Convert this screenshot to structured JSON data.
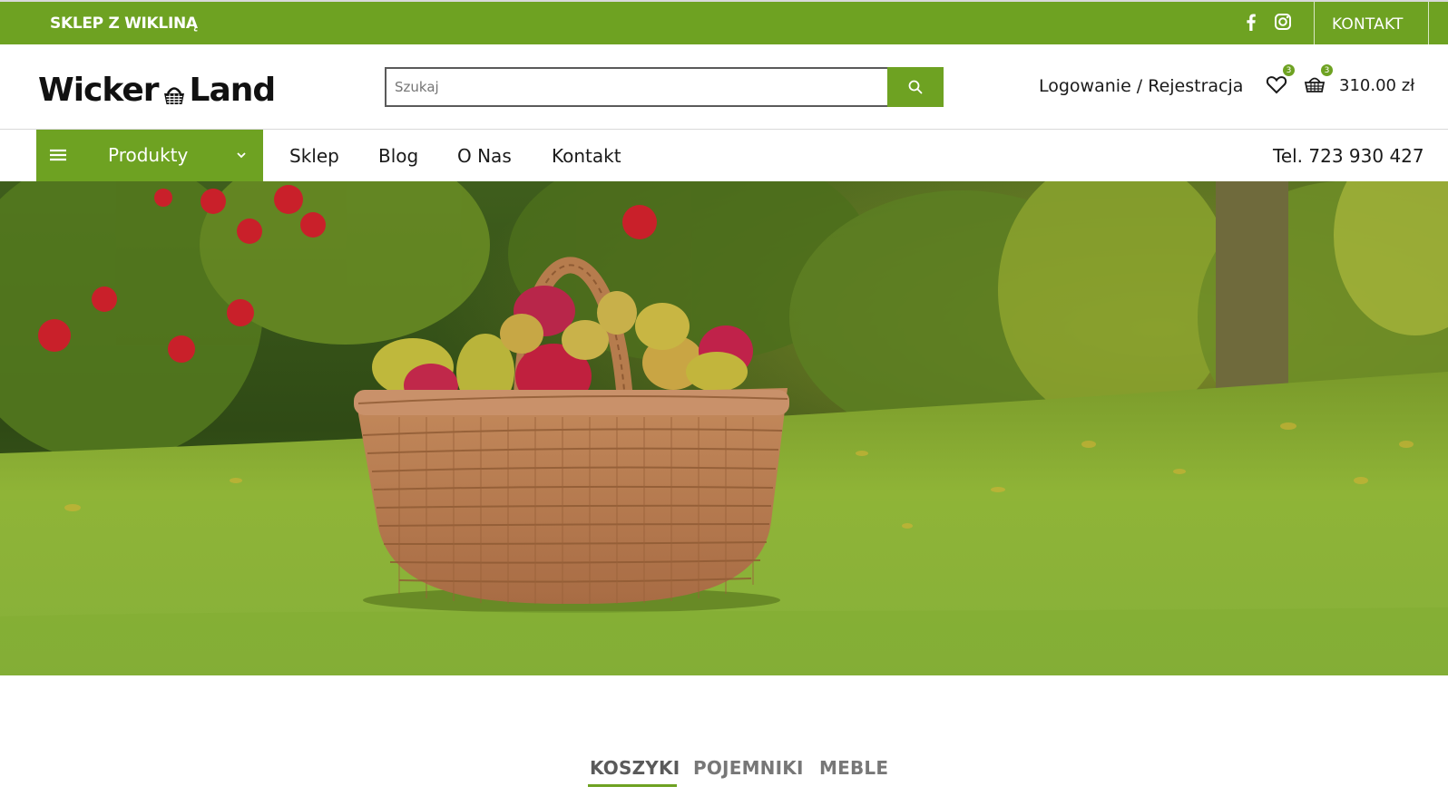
{
  "topbar": {
    "tagline": "SKLEP Z WIKLINĄ",
    "social": [
      "facebook-icon",
      "instagram-icon"
    ],
    "contact_link": "KONTAKT"
  },
  "header": {
    "logo_left": "Wicker",
    "logo_right": "Land",
    "search_placeholder": "Szukaj",
    "login_link": "Logowanie / Rejestracja",
    "wishlist_count": "3",
    "cart_count": "3",
    "cart_total": "310.00 zł"
  },
  "nav": {
    "products_menu": "Produkty",
    "links": [
      "Sklep",
      "Blog",
      "O Nas",
      "Kontakt"
    ],
    "phone": "Tel. 723 930 427"
  },
  "tabs": [
    "KOSZYKI",
    "POJEMNIKI",
    "MEBLE"
  ],
  "colors": {
    "brand_green": "#6ea222",
    "text_dark": "#1a1a1a"
  }
}
